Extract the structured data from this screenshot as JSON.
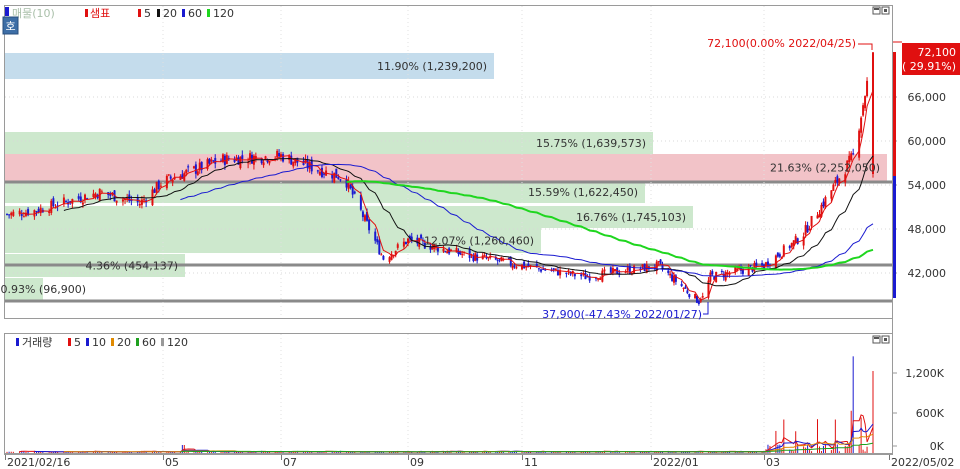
{
  "legend_price": {
    "icon_label": "호",
    "vp_label": "매물(10)",
    "candle_label": "샘표",
    "ma": [
      {
        "label": "5",
        "color": "#e01010"
      },
      {
        "label": "20",
        "color": "#111111"
      },
      {
        "label": "60",
        "color": "#1a1ad0"
      },
      {
        "label": "120",
        "color": "#1fd61f"
      }
    ]
  },
  "legend_volume": {
    "label": "거래량",
    "ma": [
      {
        "label": "5",
        "color": "#e01010"
      },
      {
        "label": "10",
        "color": "#1a1ad0"
      },
      {
        "label": "20",
        "color": "#e08a00"
      },
      {
        "label": "60",
        "color": "#1fa01f"
      },
      {
        "label": "120",
        "color": "#999999"
      }
    ]
  },
  "annotations": {
    "high": "72,100(0.00% 2022/04/25)",
    "low": "37,900(-47.43% 2022/01/27)",
    "last_price": "72,100",
    "last_change": "( 29.91%)"
  },
  "price_axis": {
    "ticks": [
      "66,000",
      "60,000",
      "54,000",
      "48,000",
      "42,000"
    ]
  },
  "volume_axis": {
    "ticks": [
      "1,200K",
      "600K",
      "0K"
    ]
  },
  "date_axis": {
    "ticks": [
      "2021/02/16",
      "05",
      "07",
      "09",
      "11",
      "2022/01",
      "03",
      "2022/05/02"
    ]
  },
  "colors": {
    "up": "#e01010",
    "down": "#1a1ad0",
    "band_green": "#cde8cd",
    "band_red": "#f2c3c8",
    "band_blue": "#c4dcec"
  },
  "chart_data": [
    {
      "type": "candlestick",
      "title": "샘표",
      "ylim": [
        36000,
        72100
      ],
      "y_ticks": [
        66000,
        60000,
        54000,
        48000,
        42000
      ],
      "high": {
        "value": 72100,
        "date": "2022/04/25",
        "pct": 0.0
      },
      "low": {
        "value": 37900,
        "date": "2022/01/27",
        "pct": -47.43
      },
      "last": {
        "value": 72100,
        "change_pct": 29.91
      },
      "close_path": [
        {
          "x": "2021/02/16",
          "y": 50000
        },
        {
          "x": "2021/03",
          "y": 50500
        },
        {
          "x": "2021/04",
          "y": 53000
        },
        {
          "x": "2021/04/20",
          "y": 51500
        },
        {
          "x": "2021/05",
          "y": 54500
        },
        {
          "x": "2021/06",
          "y": 57500
        },
        {
          "x": "2021/07",
          "y": 58000
        },
        {
          "x": "2021/07/20",
          "y": 56000
        },
        {
          "x": "2021/08",
          "y": 55000
        },
        {
          "x": "2021/08/20",
          "y": 44000
        },
        {
          "x": "2021/09",
          "y": 46500
        },
        {
          "x": "2021/10",
          "y": 44500
        },
        {
          "x": "2021/11",
          "y": 43000
        },
        {
          "x": "2021/12",
          "y": 41500
        },
        {
          "x": "2022/01/05",
          "y": 43000
        },
        {
          "x": "2022/01/27",
          "y": 37900
        },
        {
          "x": "2022/02",
          "y": 41500
        },
        {
          "x": "2022/03",
          "y": 43000
        },
        {
          "x": "2022/03/20",
          "y": 47000
        },
        {
          "x": "2022/04",
          "y": 52000
        },
        {
          "x": "2022/04/15",
          "y": 58000
        },
        {
          "x": "2022/04/25",
          "y": 72100
        }
      ],
      "volume_profile": [
        {
          "label": "11.90% (1,239,200)",
          "pct": 11.9,
          "volume": 1239200,
          "color": "blue"
        },
        {
          "label": "15.75% (1,639,573)",
          "pct": 15.75,
          "volume": 1639573,
          "color": "green"
        },
        {
          "label": "21.63% (2,252,050)",
          "pct": 21.63,
          "volume": 2252050,
          "color": "red"
        },
        {
          "label": "15.59% (1,622,450)",
          "pct": 15.59,
          "volume": 1622450,
          "color": "green"
        },
        {
          "label": "16.76% (1,745,103)",
          "pct": 16.76,
          "volume": 1745103,
          "color": "green"
        },
        {
          "label": "12.07% (1,260,460)",
          "pct": 12.07,
          "volume": 1260460,
          "color": "green"
        },
        {
          "label": "4.36% (454,137)",
          "pct": 4.36,
          "volume": 454137,
          "color": "green"
        },
        {
          "label": "0.93% (96,900)",
          "pct": 0.93,
          "volume": 96900,
          "color": "green"
        }
      ],
      "moving_averages": [
        "5",
        "20",
        "60",
        "120"
      ]
    },
    {
      "type": "bar",
      "title": "거래량",
      "ylim": [
        0,
        1500000
      ],
      "y_ticks": [
        1200000,
        600000,
        0
      ],
      "moving_averages": [
        "5",
        "10",
        "20",
        "60",
        "120"
      ]
    }
  ]
}
